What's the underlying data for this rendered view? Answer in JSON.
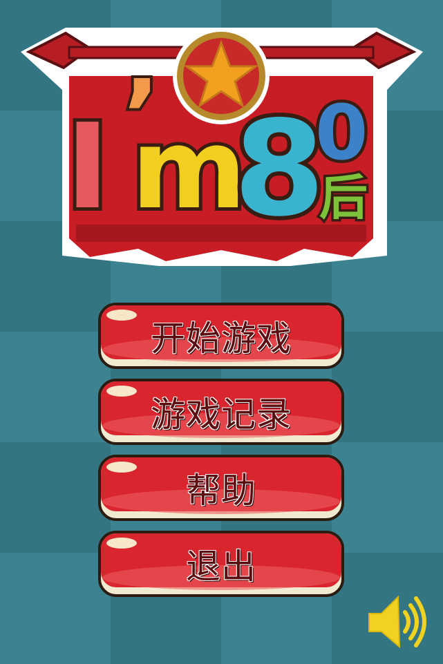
{
  "logo": {
    "text_i": "I",
    "text_apostrophe": "’",
    "text_m": "m",
    "text_8": "8",
    "text_0": "0",
    "text_hou": "后"
  },
  "menu": {
    "items": [
      {
        "label": "开始游戏"
      },
      {
        "label": "游戏记录"
      },
      {
        "label": "帮助"
      },
      {
        "label": "退出"
      }
    ]
  },
  "colors": {
    "tile_dark": "#3a7f8f",
    "tile_light": "#46949f",
    "button_red": "#d9262e",
    "button_border": "#2b1b10",
    "speaker": "#f0d320"
  },
  "icons": {
    "sound": "speaker-volume-icon"
  }
}
